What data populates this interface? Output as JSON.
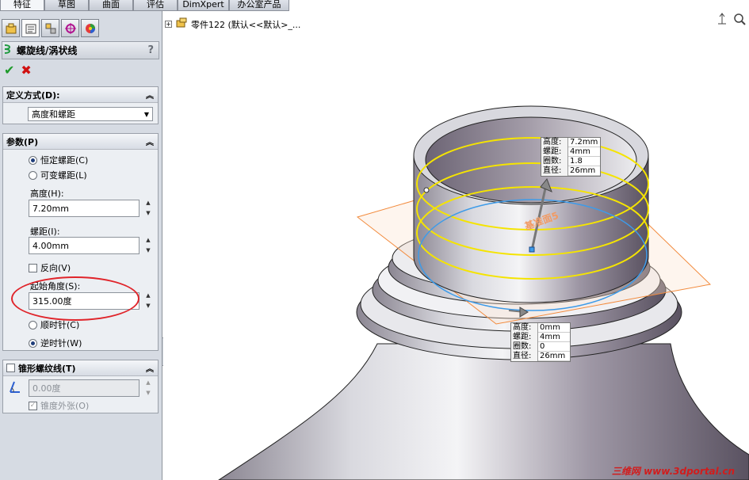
{
  "tabs": [
    {
      "label": "特征",
      "active": true
    },
    {
      "label": "草图",
      "active": false
    },
    {
      "label": "曲面",
      "active": false
    },
    {
      "label": "评估",
      "active": false
    },
    {
      "label": "DimXpert",
      "active": false
    },
    {
      "label": "办公室产品",
      "active": false
    }
  ],
  "panel": {
    "icon_tabs": [
      "feature-manager-icon",
      "property-manager-icon",
      "configuration-manager-icon",
      "dimxpert-manager-icon",
      "display-manager-icon"
    ],
    "title": "螺旋线/涡状线",
    "help": "?",
    "ok_icon": "✔",
    "cancel_icon": "✖",
    "define_group": {
      "header": "定义方式(D):",
      "selected": "高度和螺距"
    },
    "params_group": {
      "header": "参数(P)",
      "radio_constant": "恒定螺距(C)",
      "radio_variable": "可变螺距(L)",
      "height_label": "高度(H):",
      "height_value": "7.20mm",
      "pitch_label": "螺距(I):",
      "pitch_value": "4.00mm",
      "reverse_label": "反向(V)",
      "start_angle_label": "起始角度(S):",
      "start_angle_value": "315.00度",
      "clockwise_label": "顺时针(C)",
      "counterclockwise_label": "逆时针(W)"
    },
    "taper_group": {
      "header": "锥形螺纹线(T)",
      "angle_value": "0.00度",
      "taper_outward_label": "锥度外张(O)"
    }
  },
  "viewport": {
    "tree_label": "零件122 (默认<<默认>_...",
    "plane_label": "基准面5",
    "callout_top": [
      {
        "k": "高度:",
        "v": "7.2mm"
      },
      {
        "k": "螺距:",
        "v": "4mm"
      },
      {
        "k": "圈数:",
        "v": "1.8"
      },
      {
        "k": "直径:",
        "v": "26mm"
      }
    ],
    "callout_bottom": [
      {
        "k": "高度:",
        "v": "0mm"
      },
      {
        "k": "螺距:",
        "v": "4mm"
      },
      {
        "k": "圈数:",
        "v": "0"
      },
      {
        "k": "直径:",
        "v": "26mm"
      }
    ],
    "watermark": "三维网 www.3dportal.cn"
  },
  "colors": {
    "helix_yellow": "#f5e400",
    "helix_blue": "#3d9be9",
    "plane_orange": "#f4a36a",
    "highlight_red": "#e0242a"
  }
}
